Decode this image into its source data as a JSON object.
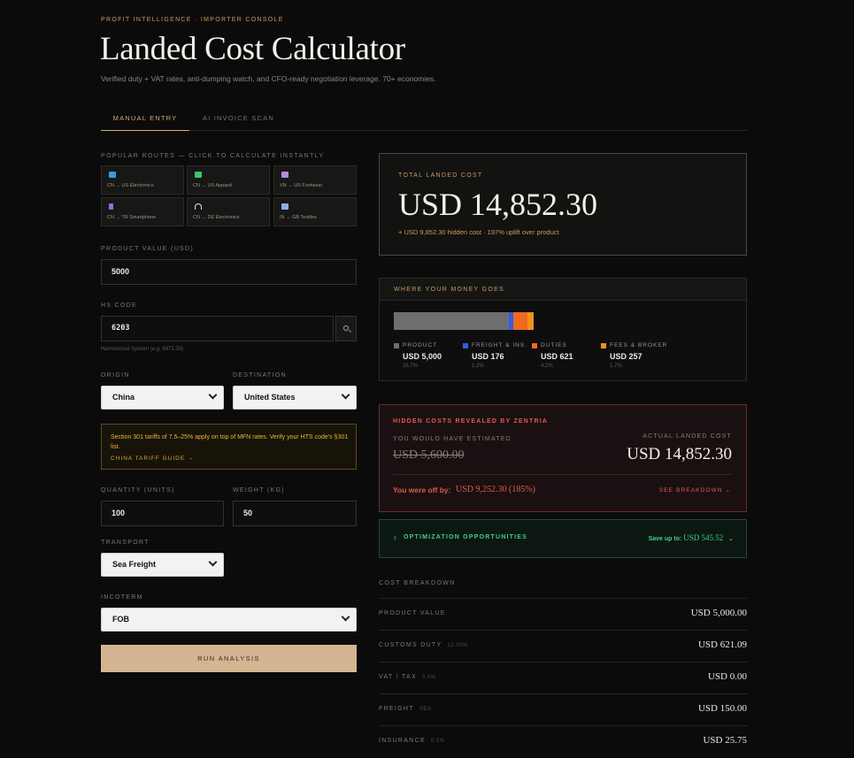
{
  "header": {
    "kicker": "PROFIT INTELLIGENCE · IMPORTER CONSOLE",
    "title": "Landed Cost Calculator",
    "subtitle": "Verified duty + VAT rates, anti-dumping watch, and CFO-ready negotiation leverage. 70+ economies."
  },
  "tabs": {
    "manual": "MANUAL ENTRY",
    "ai": "AI INVOICE SCAN"
  },
  "routes": {
    "label": "POPULAR ROUTES — CLICK TO CALCULATE INSTANTLY",
    "items": [
      {
        "label": "CN → US Electronics",
        "icon": "laptop-icon",
        "color": "#3b9bd9"
      },
      {
        "label": "CN → US Apparel",
        "icon": "shirt-icon",
        "color": "#3fc46a"
      },
      {
        "label": "VN → US Footwear",
        "icon": "shoe-icon",
        "color": "#b58ad6"
      },
      {
        "label": "CN → TR Smartphone",
        "icon": "phone-icon",
        "color": "#9b6ad6"
      },
      {
        "label": "CN → DE Electronics",
        "icon": "headphones-icon",
        "color": "#e0e0e0"
      },
      {
        "label": "IN → GB Textiles",
        "icon": "thread-icon",
        "color": "#8ab0e0"
      }
    ]
  },
  "form": {
    "product_value_label": "PRODUCT VALUE (USD)",
    "product_value": "5000",
    "hs_code_label": "HS CODE",
    "hs_code": "6203",
    "hs_hint": "Harmonized System (e.g. 8471.30)",
    "origin_label": "ORIGIN",
    "origin": "China",
    "destination_label": "DESTINATION",
    "destination": "United States",
    "notice_text": "Section 301 tariffs of 7.5–25% apply on top of MFN rates. Verify your HTS code's §301 list.",
    "notice_link": "CHINA TARIFF GUIDE →",
    "quantity_label": "QUANTITY (UNITS)",
    "quantity": "100",
    "weight_label": "WEIGHT (KG)",
    "weight": "50",
    "transport_label": "TRANSPORT",
    "transport": "Sea Freight",
    "incoterm_label": "INCOTERM",
    "incoterm": "FOB",
    "run_label": "RUN ANALYSIS"
  },
  "total": {
    "label": "TOTAL LANDED COST",
    "value": "USD 14,852.30",
    "sub": "+ USD 9,852.30 hidden cost · 197% uplift over product"
  },
  "money": {
    "title": "WHERE YOUR MONEY GOES",
    "segments": [
      {
        "name": "PRODUCT",
        "value": "USD 5,000",
        "pct": "33.7%",
        "share": 0.823,
        "color": "#6e6e70"
      },
      {
        "name": "FREIGHT & INS.",
        "value": "USD 176",
        "pct": "1.2%",
        "share": 0.029,
        "color": "#2f5fe0"
      },
      {
        "name": "DUTIES",
        "value": "USD 621",
        "pct": "4.2%",
        "share": 0.102,
        "color": "#f06a1f"
      },
      {
        "name": "FEES & BROKER",
        "value": "USD 257",
        "pct": "1.7%",
        "share": 0.046,
        "color": "#f0921f"
      }
    ]
  },
  "hidden": {
    "title": "HIDDEN COSTS REVEALED BY ZENTRIA",
    "est_label": "YOU WOULD HAVE ESTIMATED",
    "est_value": "USD 5,600.00",
    "act_label": "ACTUAL LANDED COST",
    "act_value": "USD 14,852.30",
    "off_label": "You were off by:",
    "off_value": "USD 9,252.30 (185%)",
    "see_breakdown": "SEE BREAKDOWN ⌄"
  },
  "optimization": {
    "icon": "bulb-icon",
    "title": "OPTIMIZATION OPPORTUNITIES",
    "save_label": "Save up to:",
    "save_value": "USD 545.52",
    "chevron": "⌄"
  },
  "breakdown": {
    "title": "COST BREAKDOWN",
    "rows": [
      {
        "label": "PRODUCT VALUE",
        "sub": "",
        "value": "USD 5,000.00"
      },
      {
        "label": "CUSTOMS DUTY",
        "sub": "12.00%",
        "value": "USD 621.09"
      },
      {
        "label": "VAT / TAX",
        "sub": "0.0%",
        "value": "USD 0.00"
      },
      {
        "label": "FREIGHT",
        "sub": "SEA",
        "value": "USD 150.00"
      },
      {
        "label": "INSURANCE",
        "sub": "0.5%",
        "value": "USD 25.75"
      }
    ]
  }
}
